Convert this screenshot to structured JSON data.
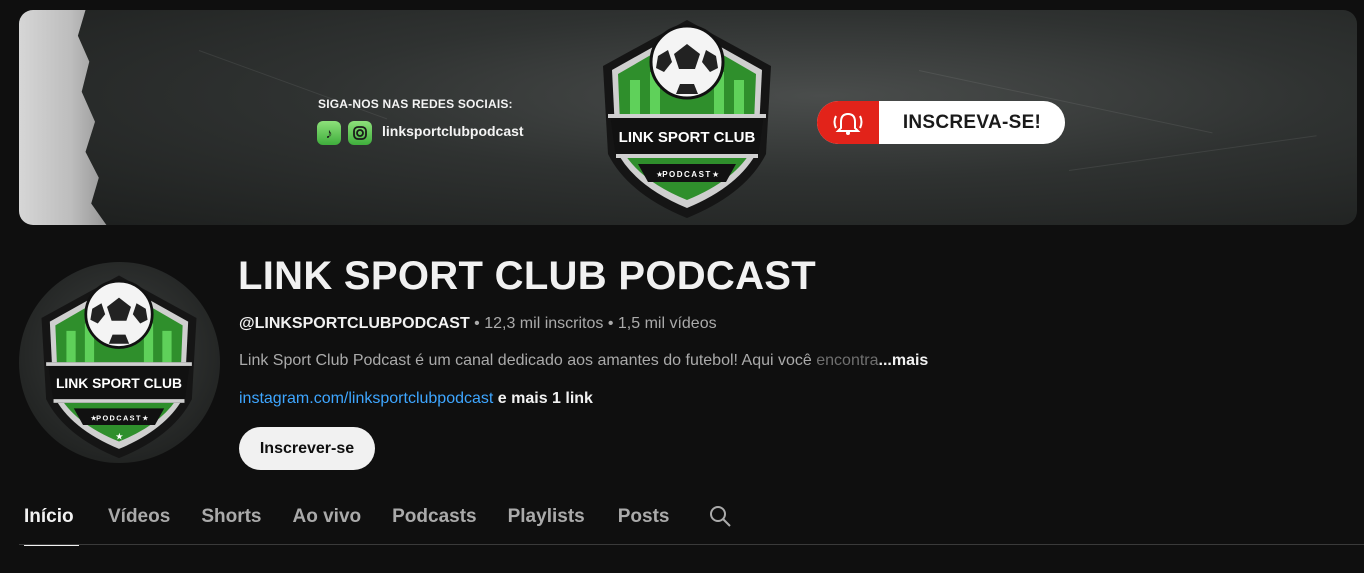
{
  "banner": {
    "follow_text": "SIGA-NOS NAS REDES SOCIAIS:",
    "social_icons": [
      "tiktok-icon",
      "instagram-icon"
    ],
    "social_handle": "linksportclubpodcast",
    "logo_text": "LINK SPORT CLUB",
    "logo_subtext": "PODCAST",
    "cta_label": "INSCREVA-SE!"
  },
  "avatar": {
    "logo_text": "LINK SPORT CLUB",
    "logo_subtext": "PODCAST"
  },
  "channel": {
    "title": "LINK SPORT CLUB PODCAST",
    "handle": "@LINKSPORTCLUBPODCAST",
    "separator1": " • ",
    "subscribers": "12,3 mil inscritos",
    "separator2": " • ",
    "videos": "1,5 mil vídeos",
    "description": "Link Sport Club Podcast é um canal dedicado aos amantes do futebol! Aqui você ",
    "description_faded": "encontra",
    "more": "...mais",
    "link": "instagram.com/linksportclubpodcast",
    "extra_links": " e mais 1 link",
    "subscribe_label": "Inscrever-se"
  },
  "tabs": [
    {
      "label": "Início",
      "active": true
    },
    {
      "label": "Vídeos"
    },
    {
      "label": "Shorts"
    },
    {
      "label": "Ao vivo"
    },
    {
      "label": "Podcasts"
    },
    {
      "label": "Playlists"
    },
    {
      "label": "Posts"
    }
  ],
  "colors": {
    "background": "#0f0f0f",
    "link": "#3ea6ff",
    "brand_green": "#3fae3c",
    "cta_red": "#e2231a"
  }
}
